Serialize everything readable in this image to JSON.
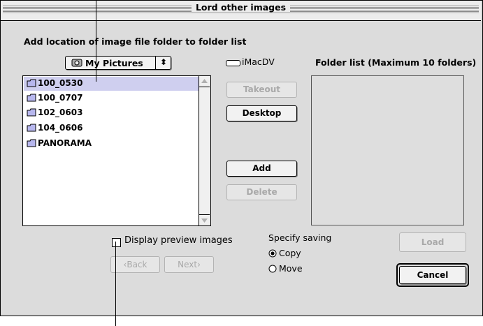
{
  "window": {
    "title": "Lord other images"
  },
  "location": {
    "label": "Add location of image file folder to folder list",
    "popup_value": "My Pictures",
    "volume_name": "iMacDV"
  },
  "folders": {
    "items": [
      "100_0530",
      "100_0707",
      "102_0603",
      "104_0606",
      "PANORAMA"
    ],
    "selected": "100_0530"
  },
  "buttons": {
    "takeout": "Takeout",
    "desktop": "Desktop",
    "add": "Add",
    "delete": "Delete",
    "back": "‹Back",
    "next": "Next›",
    "load": "Load",
    "cancel": "Cancel"
  },
  "folder_list": {
    "label": "Folder list (Maximum 10 folders)"
  },
  "preview": {
    "label": "Display preview images",
    "checked": false
  },
  "saving": {
    "label": "Specify saving",
    "options": [
      "Copy",
      "Move"
    ],
    "selected": "Copy"
  },
  "colors": {
    "selection": "#cfcfef",
    "window_bg": "#dcdcdc"
  }
}
